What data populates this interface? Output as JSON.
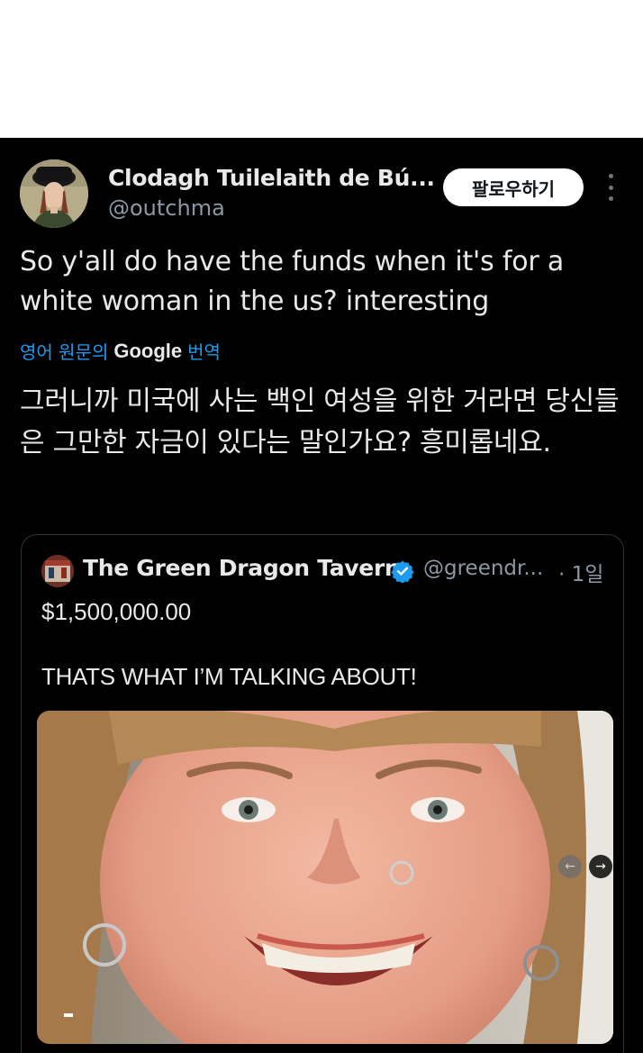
{
  "author": {
    "display_name": "Clodagh Tuilelaith de Bú...",
    "handle": "@outchma",
    "avatar_icon": "profile-photo"
  },
  "follow_button": {
    "label": "팔로우하기"
  },
  "more_icon": "more-vertical-icon",
  "tweet": {
    "text": "So y'all do have the funds when it's for a white woman in the us? interesting",
    "translate_prefix": "영어 원문의",
    "translate_brand": "Google",
    "translate_suffix": "번역",
    "translation": "그러니까 미국에 사는 백인 여성을 위한 거라면 당신들은 그만한 자금이 있다는 말인가요? 흥미롭네요."
  },
  "quoted_tweet": {
    "display_name": "The Green Dragon Tavern",
    "handle": "@greendr...",
    "time": "· 1일",
    "line1": "$1,500,000.00",
    "line2": "THATS WHAT I’M TALKING ABOUT!",
    "verified": true,
    "carousel_prev_icon": "←",
    "carousel_next_icon": "→"
  },
  "colors": {
    "background": "#000000",
    "text": "#e7e9ea",
    "secondary_text": "#8b98a5",
    "link": "#1d9bf0",
    "follow_bg": "#ffffff"
  }
}
